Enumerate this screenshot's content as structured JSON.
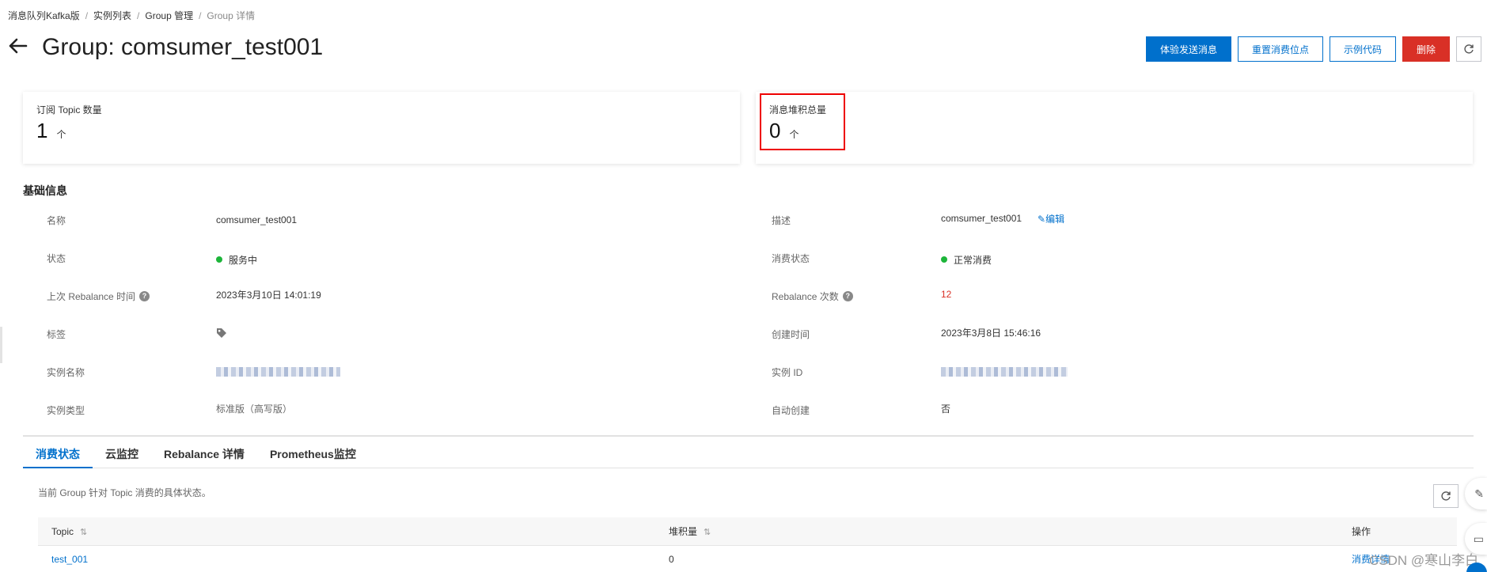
{
  "breadcrumb": [
    "消息队列Kafka版",
    "实例列表",
    "Group 管理",
    "Group 详情"
  ],
  "header": {
    "back_icon": "arrow-left-icon",
    "title": "Group: comsumer_test001"
  },
  "actions": {
    "send_test": "体验发送消息",
    "reset_offset": "重置消费位点",
    "sample_code": "示例代码",
    "delete": "删除",
    "refresh_icon": "refresh-icon"
  },
  "stats": {
    "topics": {
      "label": "订阅 Topic 数量",
      "value": "1",
      "unit": "个"
    },
    "backlog": {
      "label": "消息堆积总量",
      "value": "0",
      "unit": "个"
    }
  },
  "basic": {
    "title": "基础信息",
    "name_label": "名称",
    "name_value": "comsumer_test001",
    "desc_label": "描述",
    "desc_value": "comsumer_test001",
    "edit_label": "编辑",
    "status_label": "状态",
    "status_value": "服务中",
    "consume_status_label": "消费状态",
    "consume_status_value": "正常消费",
    "rebalance_time_label": "上次 Rebalance 时间",
    "rebalance_time_value": "2023年3月10日 14:01:19",
    "rebalance_count_label": "Rebalance 次数",
    "rebalance_count_value": "12",
    "tags_label": "标签",
    "created_label": "创建时间",
    "created_value": "2023年3月8日 15:46:16",
    "instance_name_label": "实例名称",
    "instance_id_label": "实例 ID",
    "instance_type_label": "实例类型",
    "instance_type_value": "标准版（高写版）",
    "auto_create_label": "自动创建",
    "auto_create_value": "否",
    "status_color": "#1db53a",
    "accent_color": "#0070cc",
    "danger_color": "#d93026"
  },
  "tabs": [
    "消费状态",
    "云监控",
    "Rebalance 详情",
    "Prometheus监控"
  ],
  "tab_content": {
    "description": "当前 Group 针对 Topic 消费的具体状态。"
  },
  "table": {
    "headers": {
      "topic": "Topic",
      "lag": "堆积量",
      "ops": "操作"
    },
    "rows": [
      {
        "topic": "test_001",
        "lag": "0",
        "op": "消费详情"
      }
    ]
  },
  "watermark": "CSDN @寒山李白"
}
